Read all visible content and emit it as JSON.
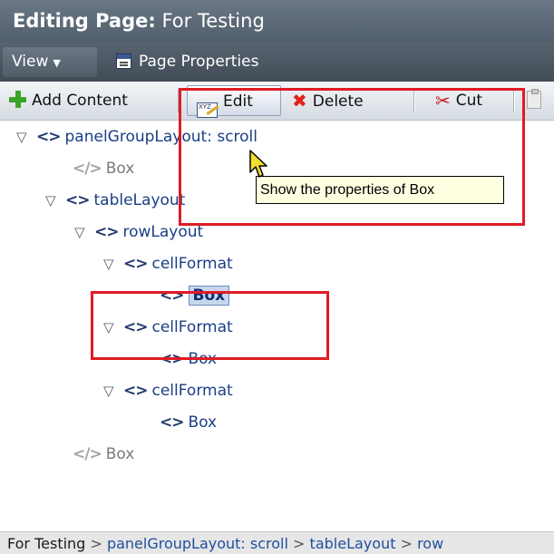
{
  "header": {
    "title_label": "Editing Page:",
    "title_value": "For Testing"
  },
  "menu": {
    "view_label": "View",
    "page_properties_label": "Page Properties"
  },
  "toolbar": {
    "add_content_label": "Add Content",
    "edit_label": "Edit",
    "edit_icon_text": "XYZ",
    "delete_label": "Delete",
    "cut_label": "Cut"
  },
  "tree": [
    {
      "label": "panelGroupLayout: scroll",
      "expanded": true,
      "enabled": true
    },
    {
      "label": "Box",
      "expanded": false,
      "enabled": false
    },
    {
      "label": "tableLayout",
      "expanded": true,
      "enabled": true
    },
    {
      "label": "rowLayout",
      "expanded": true,
      "enabled": true
    },
    {
      "label": "cellFormat",
      "expanded": true,
      "enabled": true
    },
    {
      "label": "Box",
      "expanded": false,
      "enabled": true,
      "selected": true
    },
    {
      "label": "cellFormat",
      "expanded": true,
      "enabled": true
    },
    {
      "label": "Box",
      "expanded": false,
      "enabled": true
    },
    {
      "label": "cellFormat",
      "expanded": true,
      "enabled": true
    },
    {
      "label": "Box",
      "expanded": false,
      "enabled": true
    },
    {
      "label": "Box",
      "expanded": false,
      "enabled": false
    }
  ],
  "tooltip": {
    "text": "Show the properties of Box"
  },
  "breadcrumb": {
    "items": [
      "For Testing",
      "panelGroupLayout: scroll",
      "tableLayout",
      "row"
    ],
    "separator": ">"
  },
  "colors": {
    "highlight": "#e01b24",
    "tree_text": "#1a3e86",
    "header_bg": "#5c6876"
  },
  "icons": {
    "expanded": "triangle-down-icon",
    "component": "component-tag-icon",
    "disabled_component": "disabled-component-icon",
    "add": "add-icon",
    "edit": "edit-icon",
    "delete": "delete-icon",
    "cut": "scissors-icon",
    "paste": "paste-icon"
  }
}
